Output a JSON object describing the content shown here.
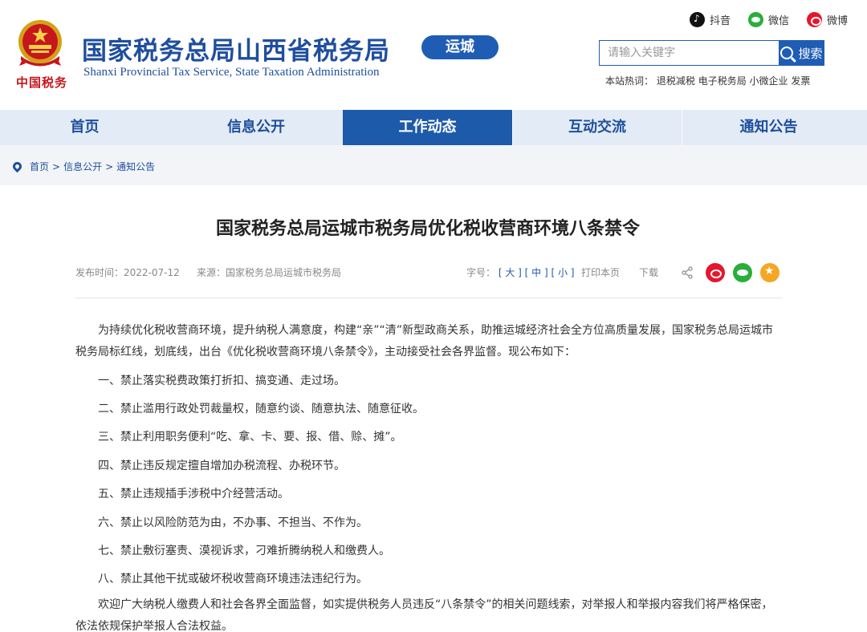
{
  "header": {
    "emblem_caption": "中国税务",
    "title": "国家税务总局山西省税务局",
    "subtitle": "Shanxi Provincial Tax Service, State Taxation Administration",
    "city": "运城",
    "social": [
      {
        "label": "抖音",
        "icon": "douyin-icon"
      },
      {
        "label": "微信",
        "icon": "wechat-icon"
      },
      {
        "label": "微博",
        "icon": "weibo-icon"
      }
    ],
    "search_placeholder": "请输入关键字",
    "search_label": "搜索",
    "hot_prefix": "本站热词：",
    "hot_words": [
      "退税减税",
      "电子税务局",
      "小微企业",
      "发票"
    ]
  },
  "nav": {
    "items": [
      "首页",
      "信息公开",
      "工作动态",
      "互动交流",
      "通知公告"
    ],
    "active_index": 2
  },
  "breadcrumb": {
    "items": [
      "首页",
      "信息公开",
      "通知公告"
    ],
    "separator": ">"
  },
  "article": {
    "title": "国家税务总局运城市税务局优化税收营商环境八条禁令",
    "date": "发布时间：2022-07-12",
    "source": "来源：国家税务总局运城市税务局",
    "font_size_label": "字号：",
    "font_sizes": [
      "[ 大 ]",
      "[ 中 ]",
      "[ 小 ]"
    ],
    "print_label": "打印本页",
    "download_label": "下载",
    "intro": "为持续优化税收营商环境，提升纳税人满意度，构建“亲”“清”新型政商关系，助推运城经济社会全方位高质量发展，国家税务总局运城市税务局标红线，划底线，出台《优化税收营商环境八条禁令》，主动接受社会各界监督。现公布如下：",
    "items": [
      "一、禁止落实税费政策打折扣、搞变通、走过场。",
      "二、禁止滥用行政处罚裁量权，随意约谈、随意执法、随意征收。",
      "三、禁止利用职务便利“吃、拿、卡、要、报、借、赊、摊”。",
      "四、禁止违反规定擅自增加办税流程、办税环节。",
      "五、禁止违规插手涉税中介经营活动。",
      "六、禁止以风险防范为由，不办事、不担当、不作为。",
      "七、禁止敷衍塞责、漠视诉求，刁难折腾纳税人和缴费人。",
      "八、禁止其他干扰或破坏税收营商环境违法违纪行为。"
    ],
    "closing": "欢迎广大纳税人缴费人和社会各界全面监督，如实提供税务人员违反“八条禁令”的相关问题线索，对举报人和举报内容我们将严格保密，依法依规保护举报人合法权益。"
  },
  "colors": {
    "brand_blue": "#1f4e9e",
    "nav_active": "#1e5aaa",
    "nav_bg": "#e3ebf6",
    "emblem_red": "#c8161d"
  }
}
